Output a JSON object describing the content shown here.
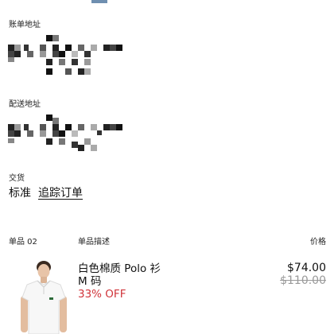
{
  "billing": {
    "label": "账单地址"
  },
  "shipping": {
    "label": "配送地址"
  },
  "delivery": {
    "label": "交货",
    "method": "标准",
    "track_link": "追踪订单"
  },
  "items_header": {
    "count_label": "单品 02",
    "desc_label": "单品描述",
    "price_label": "价格"
  },
  "item": {
    "name": "白色棉质 Polo 衫",
    "size": "M 码",
    "discount": "33% OFF",
    "price": "$74.00",
    "original_price": "$110.00"
  },
  "colors": {
    "discount": "#d0343a",
    "muted": "#9a9a9a",
    "tab_accent": "#6f8fb0"
  }
}
